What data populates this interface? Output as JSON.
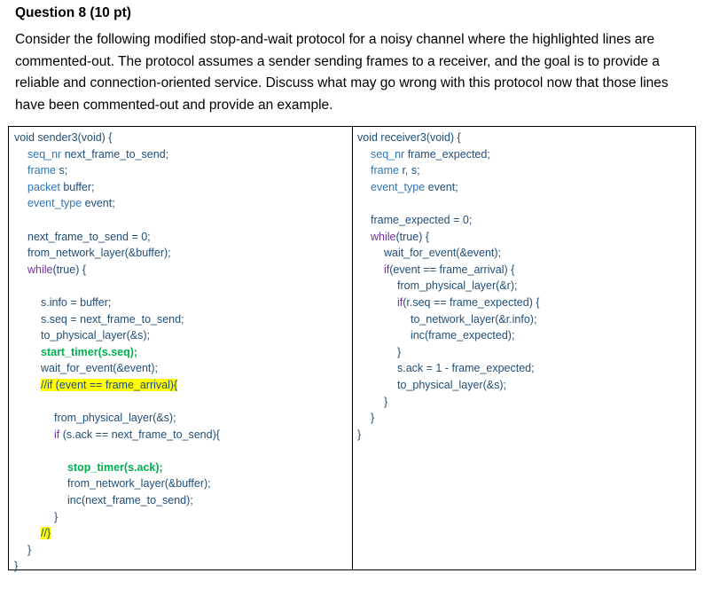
{
  "question": {
    "title": "Question 8 (10 pt)",
    "body_lines": [
      "Consider the following modified stop-and-wait protocol for a noisy channel where the highlighted lines are",
      "commented-out. The protocol assumes a sender sending frames to a receiver, and the goal is to provide a",
      "reliable and connection-oriented service. Discuss what may go wrong with this protocol now that those lines",
      "have been commented-out and provide an example."
    ]
  },
  "colors": {
    "keyword": "#7030a0",
    "type": "#2e75b6",
    "identifier": "#1f4e79",
    "plain": "#000000",
    "bold_green": "#00b050",
    "highlight": "#ffff00"
  },
  "sender_code": [
    {
      "indent": 0,
      "segments": [
        {
          "t": "void sender3(void) {",
          "c": "identifier"
        }
      ]
    },
    {
      "indent": 1,
      "segments": [
        {
          "t": "seq_nr ",
          "c": "type"
        },
        {
          "t": "next_frame_to_send;",
          "c": "identifier"
        }
      ]
    },
    {
      "indent": 1,
      "segments": [
        {
          "t": "frame ",
          "c": "type"
        },
        {
          "t": "s;",
          "c": "identifier"
        }
      ]
    },
    {
      "indent": 1,
      "segments": [
        {
          "t": "packet ",
          "c": "type"
        },
        {
          "t": "buffer;",
          "c": "identifier"
        }
      ]
    },
    {
      "indent": 1,
      "segments": [
        {
          "t": "event_type ",
          "c": "type"
        },
        {
          "t": "event;",
          "c": "identifier"
        }
      ]
    },
    {
      "indent": 0,
      "segments": []
    },
    {
      "indent": 1,
      "segments": [
        {
          "t": "next_frame_to_send = 0;",
          "c": "identifier"
        }
      ]
    },
    {
      "indent": 1,
      "segments": [
        {
          "t": "from_network_layer(&buffer);",
          "c": "identifier"
        }
      ]
    },
    {
      "indent": 1,
      "segments": [
        {
          "t": "while",
          "c": "keyword"
        },
        {
          "t": "(true) {",
          "c": "identifier"
        }
      ]
    },
    {
      "indent": 0,
      "segments": []
    },
    {
      "indent": 2,
      "segments": [
        {
          "t": "s.info = buffer;",
          "c": "identifier"
        }
      ]
    },
    {
      "indent": 2,
      "segments": [
        {
          "t": "s.seq = next_frame_to_send;",
          "c": "identifier"
        }
      ]
    },
    {
      "indent": 2,
      "segments": [
        {
          "t": "to_physical_layer(&s);",
          "c": "identifier"
        }
      ]
    },
    {
      "indent": 2,
      "segments": [
        {
          "t": "start_timer(s.seq);",
          "c": "bold_green"
        }
      ]
    },
    {
      "indent": 2,
      "segments": [
        {
          "t": "wait_for_event(&event);",
          "c": "identifier"
        }
      ]
    },
    {
      "indent": 2,
      "hl": true,
      "segments": [
        {
          "t": "//if (event == frame_arrival){",
          "c": "identifier"
        }
      ]
    },
    {
      "indent": 0,
      "segments": []
    },
    {
      "indent": 3,
      "segments": [
        {
          "t": "from_physical_layer(&s);",
          "c": "identifier"
        }
      ]
    },
    {
      "indent": 3,
      "segments": [
        {
          "t": "if ",
          "c": "keyword"
        },
        {
          "t": "(s.ack == next_frame_to_send){",
          "c": "identifier"
        }
      ]
    },
    {
      "indent": 0,
      "segments": []
    },
    {
      "indent": 4,
      "segments": [
        {
          "t": "stop_timer(s.ack);",
          "c": "bold_green"
        }
      ]
    },
    {
      "indent": 4,
      "segments": [
        {
          "t": "from_network_layer(&buffer);",
          "c": "identifier"
        }
      ]
    },
    {
      "indent": 4,
      "segments": [
        {
          "t": "inc(next_frame_to_send);",
          "c": "identifier"
        }
      ]
    },
    {
      "indent": 3,
      "segments": [
        {
          "t": "}",
          "c": "identifier"
        }
      ]
    },
    {
      "indent": 2,
      "hl": true,
      "segments": [
        {
          "t": "//}",
          "c": "identifier"
        }
      ]
    },
    {
      "indent": 1,
      "segments": [
        {
          "t": "}",
          "c": "identifier"
        }
      ]
    },
    {
      "indent": 0,
      "segments": [
        {
          "t": "}",
          "c": "identifier"
        }
      ]
    }
  ],
  "receiver_code": [
    {
      "indent": 0,
      "segments": [
        {
          "t": "void receiver3(void) {",
          "c": "identifier"
        }
      ]
    },
    {
      "indent": 1,
      "segments": [
        {
          "t": "seq_nr ",
          "c": "type"
        },
        {
          "t": "frame_expected;",
          "c": "identifier"
        }
      ]
    },
    {
      "indent": 1,
      "segments": [
        {
          "t": "frame ",
          "c": "type"
        },
        {
          "t": "r, s;",
          "c": "identifier"
        }
      ]
    },
    {
      "indent": 1,
      "segments": [
        {
          "t": "event_type ",
          "c": "type"
        },
        {
          "t": "event;",
          "c": "identifier"
        }
      ]
    },
    {
      "indent": 0,
      "segments": []
    },
    {
      "indent": 1,
      "segments": [
        {
          "t": "frame_expected = 0;",
          "c": "identifier"
        }
      ]
    },
    {
      "indent": 1,
      "segments": [
        {
          "t": "while",
          "c": "keyword"
        },
        {
          "t": "(true) {",
          "c": "identifier"
        }
      ]
    },
    {
      "indent": 2,
      "segments": [
        {
          "t": "wait_for_event(&event);",
          "c": "identifier"
        }
      ]
    },
    {
      "indent": 2,
      "segments": [
        {
          "t": "if",
          "c": "keyword"
        },
        {
          "t": "(event == frame_arrival) {",
          "c": "identifier"
        }
      ]
    },
    {
      "indent": 3,
      "segments": [
        {
          "t": "from_physical_layer(&r);",
          "c": "identifier"
        }
      ]
    },
    {
      "indent": 3,
      "segments": [
        {
          "t": "if",
          "c": "keyword"
        },
        {
          "t": "(r.seq == frame_expected) {",
          "c": "identifier"
        }
      ]
    },
    {
      "indent": 4,
      "segments": [
        {
          "t": "to_network_layer(&r.info);",
          "c": "identifier"
        }
      ]
    },
    {
      "indent": 4,
      "segments": [
        {
          "t": "inc(frame_expected);",
          "c": "identifier"
        }
      ]
    },
    {
      "indent": 3,
      "segments": [
        {
          "t": "}",
          "c": "identifier"
        }
      ]
    },
    {
      "indent": 3,
      "segments": [
        {
          "t": "s.ack = 1 - frame_expected;",
          "c": "identifier"
        }
      ]
    },
    {
      "indent": 3,
      "segments": [
        {
          "t": "to_physical_layer(&s);",
          "c": "identifier"
        }
      ]
    },
    {
      "indent": 2,
      "segments": [
        {
          "t": "}",
          "c": "identifier"
        }
      ]
    },
    {
      "indent": 1,
      "segments": [
        {
          "t": "}",
          "c": "identifier"
        }
      ]
    },
    {
      "indent": 0,
      "segments": [
        {
          "t": "}",
          "c": "identifier"
        }
      ]
    }
  ]
}
